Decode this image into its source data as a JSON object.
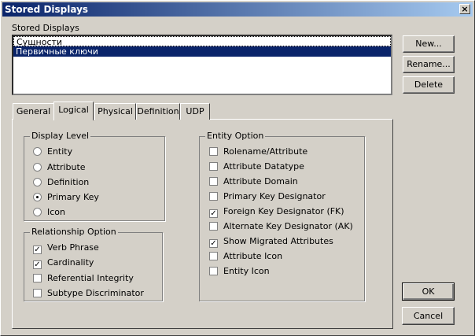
{
  "window": {
    "title": "Stored Displays",
    "close_glyph": "×"
  },
  "stored_displays": {
    "label": "Stored Displays",
    "items": [
      "Сущности",
      "Первичные ключи"
    ],
    "selected_index": 1
  },
  "buttons": {
    "new": "New...",
    "rename": "Rename...",
    "delete": "Delete",
    "ok": "OK",
    "cancel": "Cancel"
  },
  "tabs": [
    {
      "label": "General",
      "active": false
    },
    {
      "label": "Logical",
      "active": true
    },
    {
      "label": "Physical",
      "active": false
    },
    {
      "label": "Definition",
      "active": false
    },
    {
      "label": "UDP",
      "active": false
    }
  ],
  "display_level": {
    "title": "Display Level",
    "options": [
      {
        "label": "Entity",
        "selected": false
      },
      {
        "label": "Attribute",
        "selected": false
      },
      {
        "label": "Definition",
        "selected": false
      },
      {
        "label": "Primary Key",
        "selected": true
      },
      {
        "label": "Icon",
        "selected": false
      }
    ]
  },
  "relationship_option": {
    "title": "Relationship Option",
    "options": [
      {
        "label": "Verb Phrase",
        "checked": true
      },
      {
        "label": "Cardinality",
        "checked": true
      },
      {
        "label": "Referential Integrity",
        "checked": false
      },
      {
        "label": "Subtype Discriminator",
        "checked": false
      }
    ]
  },
  "entity_option": {
    "title": "Entity Option",
    "options": [
      {
        "label": "Rolename/Attribute",
        "checked": false
      },
      {
        "label": "Attribute Datatype",
        "checked": false
      },
      {
        "label": "Attribute Domain",
        "checked": false
      },
      {
        "label": "Primary Key Designator",
        "checked": false
      },
      {
        "label": "Foreign Key Designator (FK)",
        "checked": true
      },
      {
        "label": "Alternate Key Designator (AK)",
        "checked": false
      },
      {
        "label": "Show Migrated Attributes",
        "checked": true
      },
      {
        "label": "Attribute Icon",
        "checked": false
      },
      {
        "label": "Entity Icon",
        "checked": false
      }
    ]
  }
}
